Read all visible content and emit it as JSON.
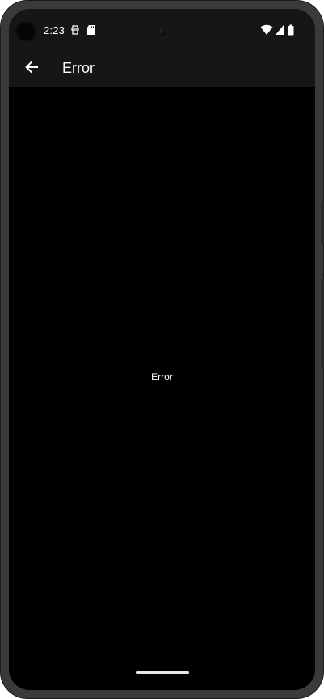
{
  "status_bar": {
    "time": "2:23",
    "icons": [
      "usb-debug-icon",
      "sd-card-icon",
      "wifi-icon",
      "cell-signal-icon",
      "battery-icon"
    ]
  },
  "app_bar": {
    "back_icon": "arrow-back-icon",
    "title": "Error"
  },
  "content": {
    "message": "Error"
  },
  "colors": {
    "background": "#000000",
    "app_bar": "#161616",
    "text": "#ffffff"
  }
}
